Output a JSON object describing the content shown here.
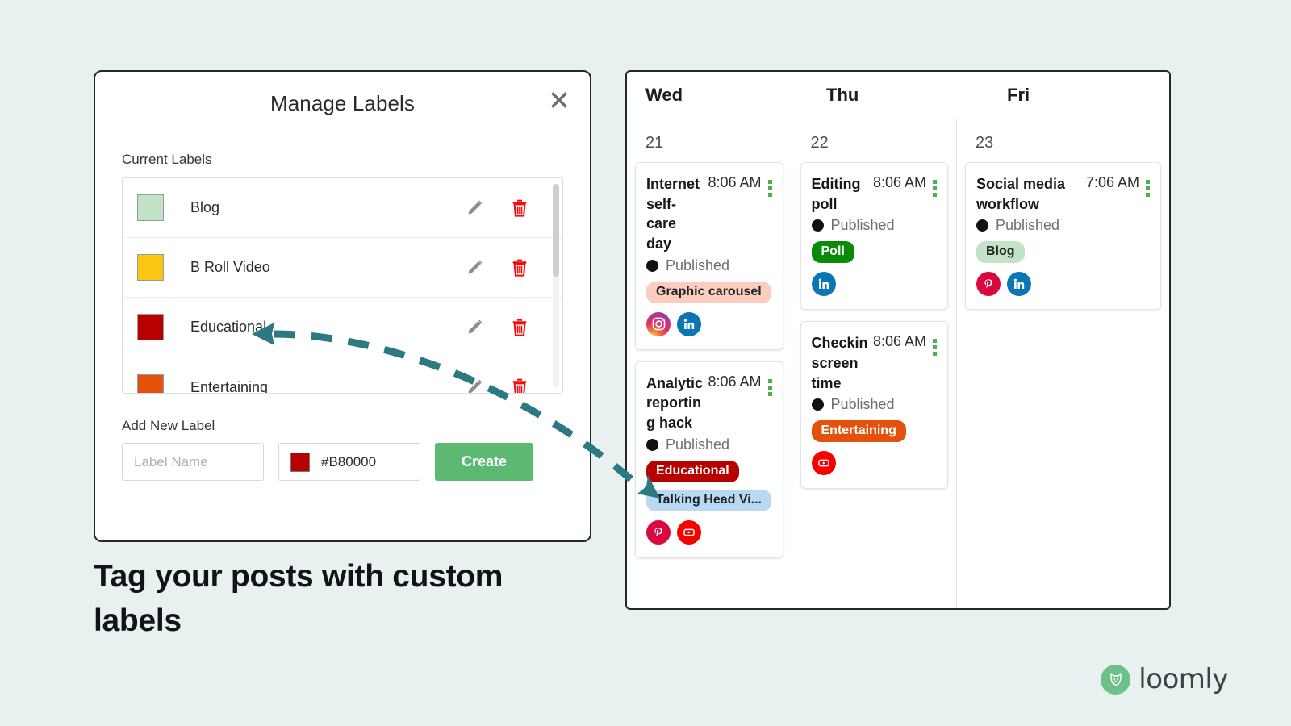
{
  "page": {
    "background_color": "#e8f1ef",
    "headline": "Tag your posts with custom labels"
  },
  "modal": {
    "title": "Manage Labels",
    "close_icon": "close-x-icon",
    "current_labels_heading": "Current Labels",
    "labels": [
      {
        "name": "Blog",
        "color": "#c3e2c6",
        "edit_icon": "pencil-icon",
        "delete_icon": "trash-icon"
      },
      {
        "name": "B Roll Video",
        "color": "#f9c712",
        "edit_icon": "pencil-icon",
        "delete_icon": "trash-icon"
      },
      {
        "name": "Educational",
        "color": "#b80000",
        "edit_icon": "pencil-icon",
        "delete_icon": "trash-icon"
      },
      {
        "name": "Entertaining",
        "color": "#e4510d",
        "edit_icon": "pencil-icon",
        "delete_icon": "trash-icon"
      }
    ],
    "add_new": {
      "heading": "Add New Label",
      "name_placeholder": "Label Name",
      "name_value": "",
      "color_value": "#B80000",
      "color_swatch": "#b80000",
      "create_label": "Create",
      "create_color": "#5cb972"
    }
  },
  "calendar": {
    "columns": [
      {
        "weekday": "Wed",
        "daynum": "21",
        "posts": [
          {
            "title": "Internet self-care day",
            "time": "8:06 AM",
            "menu_icon": "kebab-menu-icon",
            "status": "Published",
            "status_dot_color": "#111111",
            "pills": [
              {
                "text": "Graphic carousel",
                "bg": "#fbcdbe",
                "fg": "#1e2326"
              }
            ],
            "socials": [
              "instagram-icon",
              "linkedin-icon"
            ]
          },
          {
            "title": "Analytic reporting hack",
            "time": "8:06 AM",
            "menu_icon": "kebab-menu-icon",
            "status": "Published",
            "status_dot_color": "#111111",
            "pills": [
              {
                "text": "Educational",
                "bg": "#b80000",
                "fg": "#ffffff"
              },
              {
                "text": "Talking Head Vi...",
                "bg": "#b9d9f1",
                "fg": "#1e2326"
              }
            ],
            "socials": [
              "pinterest-icon",
              "youtube-icon"
            ]
          }
        ]
      },
      {
        "weekday": "Thu",
        "daynum": "22",
        "posts": [
          {
            "title": "Editing poll",
            "time": "8:06 AM",
            "menu_icon": "kebab-menu-icon",
            "status": "Published",
            "status_dot_color": "#111111",
            "pills": [
              {
                "text": "Poll",
                "bg": "#098a09",
                "fg": "#ffffff"
              }
            ],
            "socials": [
              "linkedin-icon"
            ]
          },
          {
            "title": "Checkin screen time",
            "time": "8:06 AM",
            "menu_icon": "kebab-menu-icon",
            "status": "Published",
            "status_dot_color": "#111111",
            "pills": [
              {
                "text": "Entertaining",
                "bg": "#e4510d",
                "fg": "#ffffff"
              }
            ],
            "socials": [
              "youtube-icon"
            ]
          }
        ]
      },
      {
        "weekday": "Fri",
        "daynum": "23",
        "posts": [
          {
            "title": "Social media workflow",
            "time": "7:06 AM",
            "menu_icon": "kebab-menu-icon",
            "status": "Published",
            "status_dot_color": "#111111",
            "pills": [
              {
                "text": "Blog",
                "bg": "#c3e2c6",
                "fg": "#1e2326"
              }
            ],
            "socials": [
              "pinterest-icon",
              "linkedin-icon"
            ]
          }
        ]
      }
    ]
  },
  "annotation": {
    "arrow_color": "#2b7a82",
    "arrow_style": "dashed-curved-double-arrow"
  },
  "branding": {
    "logo_text": "loomly",
    "logo_mark_color": "#6cc18a",
    "logo_mark_icon": "loomly-cat-icon"
  }
}
